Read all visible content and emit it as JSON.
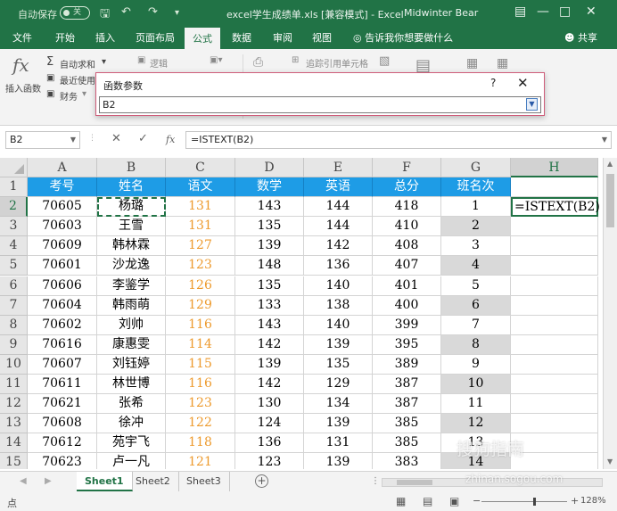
{
  "titlebar": {
    "autosave_label": "自动保存",
    "autosave_state": "关",
    "doc_title": "excel学生成绩单.xls  [兼容模式]  -  Excel",
    "user": "Midwinter Bear"
  },
  "menu": {
    "tabs": [
      "文件",
      "开始",
      "插入",
      "页面布局",
      "公式",
      "数据",
      "审阅",
      "视图"
    ],
    "active": "公式",
    "tellme": "告诉我你想要做什么",
    "share": "共享"
  },
  "ribbon": {
    "insert_function": "插入函数",
    "autosum": "自动求和",
    "recent": "最近使用",
    "financial": "财务",
    "logical": "逻辑",
    "trace_precedents": "追踪引用单元格"
  },
  "fn_dialog": {
    "title": "函数参数",
    "help": "?",
    "input_value": "B2"
  },
  "formula_bar": {
    "name_box": "B2",
    "formula": "=ISTEXT(B2)"
  },
  "grid": {
    "columns": [
      "A",
      "B",
      "C",
      "D",
      "E",
      "F",
      "G",
      "H"
    ],
    "selected_column": "H",
    "rows": [
      "1",
      "2",
      "3",
      "4",
      "5",
      "6",
      "7",
      "8",
      "9",
      "10",
      "11",
      "12",
      "13",
      "14",
      "15"
    ],
    "selected_row": "2",
    "header_row": [
      "考号",
      "姓名",
      "语文",
      "数学",
      "英语",
      "总分",
      "班名次",
      ""
    ],
    "data": [
      [
        "70605",
        "杨璐",
        "131",
        "143",
        "144",
        "418",
        "1",
        "=ISTEXT(B2)"
      ],
      [
        "70603",
        "王雪",
        "131",
        "135",
        "144",
        "410",
        "2",
        ""
      ],
      [
        "70609",
        "韩林霖",
        "127",
        "139",
        "142",
        "408",
        "3",
        ""
      ],
      [
        "70601",
        "沙龙逸",
        "123",
        "148",
        "136",
        "407",
        "4",
        ""
      ],
      [
        "70606",
        "李鉴学",
        "126",
        "135",
        "140",
        "401",
        "5",
        ""
      ],
      [
        "70604",
        "韩雨萌",
        "129",
        "133",
        "138",
        "400",
        "6",
        ""
      ],
      [
        "70602",
        "刘帅",
        "116",
        "143",
        "140",
        "399",
        "7",
        ""
      ],
      [
        "70616",
        "康惠雯",
        "114",
        "142",
        "139",
        "395",
        "8",
        ""
      ],
      [
        "70607",
        "刘钰婷",
        "115",
        "139",
        "135",
        "389",
        "9",
        ""
      ],
      [
        "70611",
        "林世博",
        "116",
        "142",
        "129",
        "387",
        "10",
        ""
      ],
      [
        "70621",
        "张希",
        "123",
        "130",
        "134",
        "387",
        "11",
        ""
      ],
      [
        "70608",
        "徐冲",
        "122",
        "124",
        "139",
        "385",
        "12",
        ""
      ],
      [
        "70612",
        "苑宇飞",
        "118",
        "136",
        "131",
        "385",
        "13",
        ""
      ],
      [
        "70623",
        "卢一凡",
        "121",
        "123",
        "139",
        "383",
        "14",
        ""
      ]
    ]
  },
  "sheets": {
    "tabs": [
      "Sheet1",
      "Sheet2",
      "Sheet3"
    ],
    "active": "Sheet1"
  },
  "status": {
    "mode": "点",
    "zoom": "128%"
  },
  "watermark": {
    "text": "搜狗指南",
    "sub": "zhinan.sogou.com"
  },
  "colors": {
    "excel_green": "#217346",
    "header_blue": "#1e9ce6",
    "chinese_score_orange": "#ed9a2d",
    "rank_gray": "#d9d9d9"
  }
}
